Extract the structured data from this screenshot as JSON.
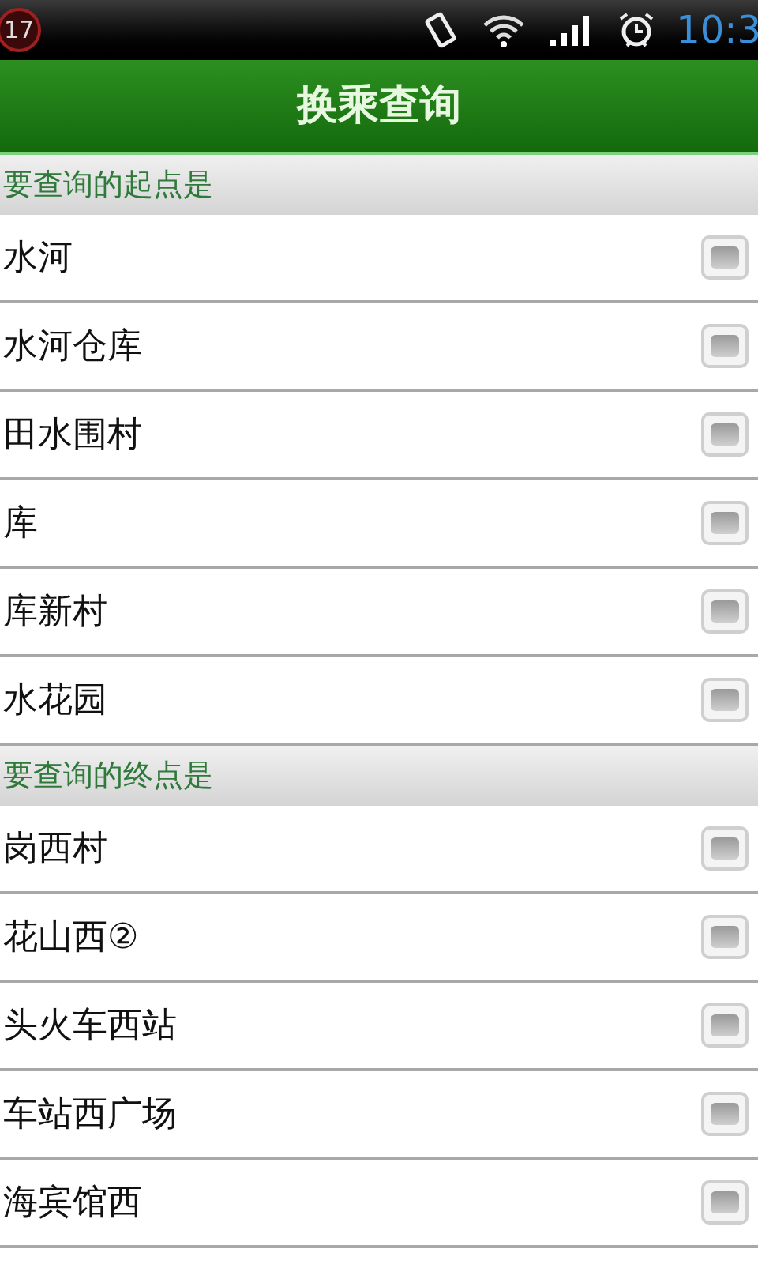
{
  "status_bar": {
    "badge": "17",
    "time": "10:3"
  },
  "title": "换乘查询",
  "sections": [
    {
      "header": "要查询的起点是",
      "items": [
        {
          "label": "水河",
          "checked": false
        },
        {
          "label": "水河仓库",
          "checked": false
        },
        {
          "label": "田水围村",
          "checked": false
        },
        {
          "label": "库",
          "checked": false
        },
        {
          "label": "库新村",
          "checked": false
        },
        {
          "label": "水花园",
          "checked": false
        }
      ]
    },
    {
      "header": "要查询的终点是",
      "items": [
        {
          "label": "岗西村",
          "checked": false
        },
        {
          "label": "花山西②",
          "checked": false
        },
        {
          "label": "头火车西站",
          "checked": false
        },
        {
          "label": "车站西广场",
          "checked": false
        },
        {
          "label": "海宾馆西",
          "checked": false
        }
      ]
    }
  ]
}
